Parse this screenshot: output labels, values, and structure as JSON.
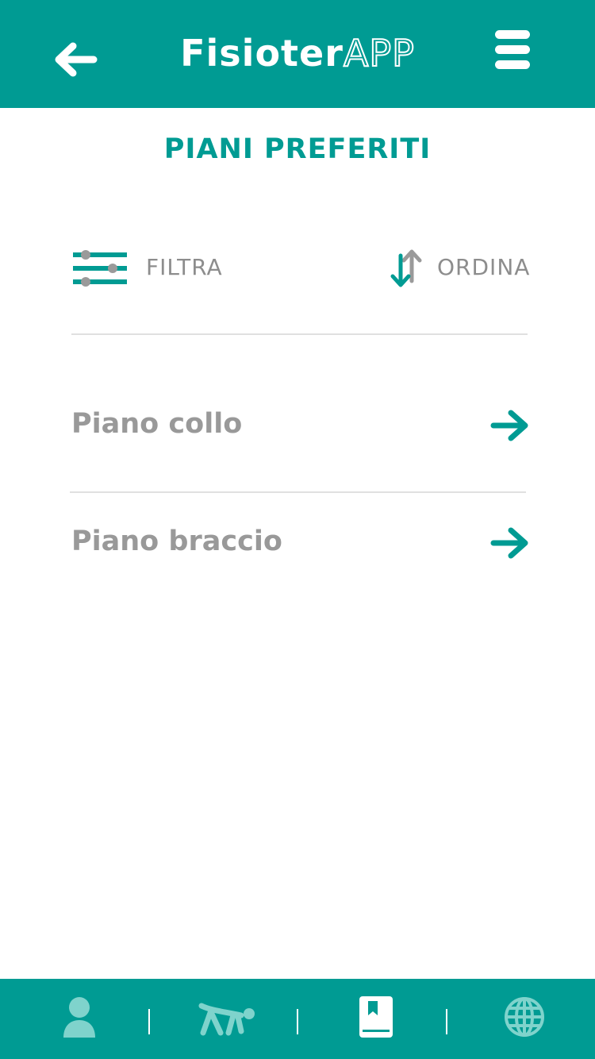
{
  "header": {
    "back_icon": "arrow-left-icon",
    "title_bold": "Fisioter",
    "title_outline": "APP",
    "menu_icon": "hamburger-menu-icon"
  },
  "page": {
    "title": "PIANI PREFERITI"
  },
  "toolbar": {
    "filter_label": "FILTRA",
    "filter_icon": "filter-sliders-icon",
    "sort_label": "ORDINA",
    "sort_icon": "sort-arrows-icon"
  },
  "plans": [
    {
      "label": "Piano collo",
      "icon": "arrow-right-icon"
    },
    {
      "label": "Piano braccio",
      "icon": "arrow-right-icon"
    }
  ],
  "bottom_nav": {
    "items": [
      {
        "icon": "user-profile-icon"
      },
      {
        "icon": "exercise-icon"
      },
      {
        "icon": "bookmark-book-icon",
        "active": true
      },
      {
        "icon": "globe-icon"
      }
    ]
  },
  "colors": {
    "primary": "#009b93",
    "text_gray": "#999999",
    "icon_light": "#7fd3cc"
  }
}
